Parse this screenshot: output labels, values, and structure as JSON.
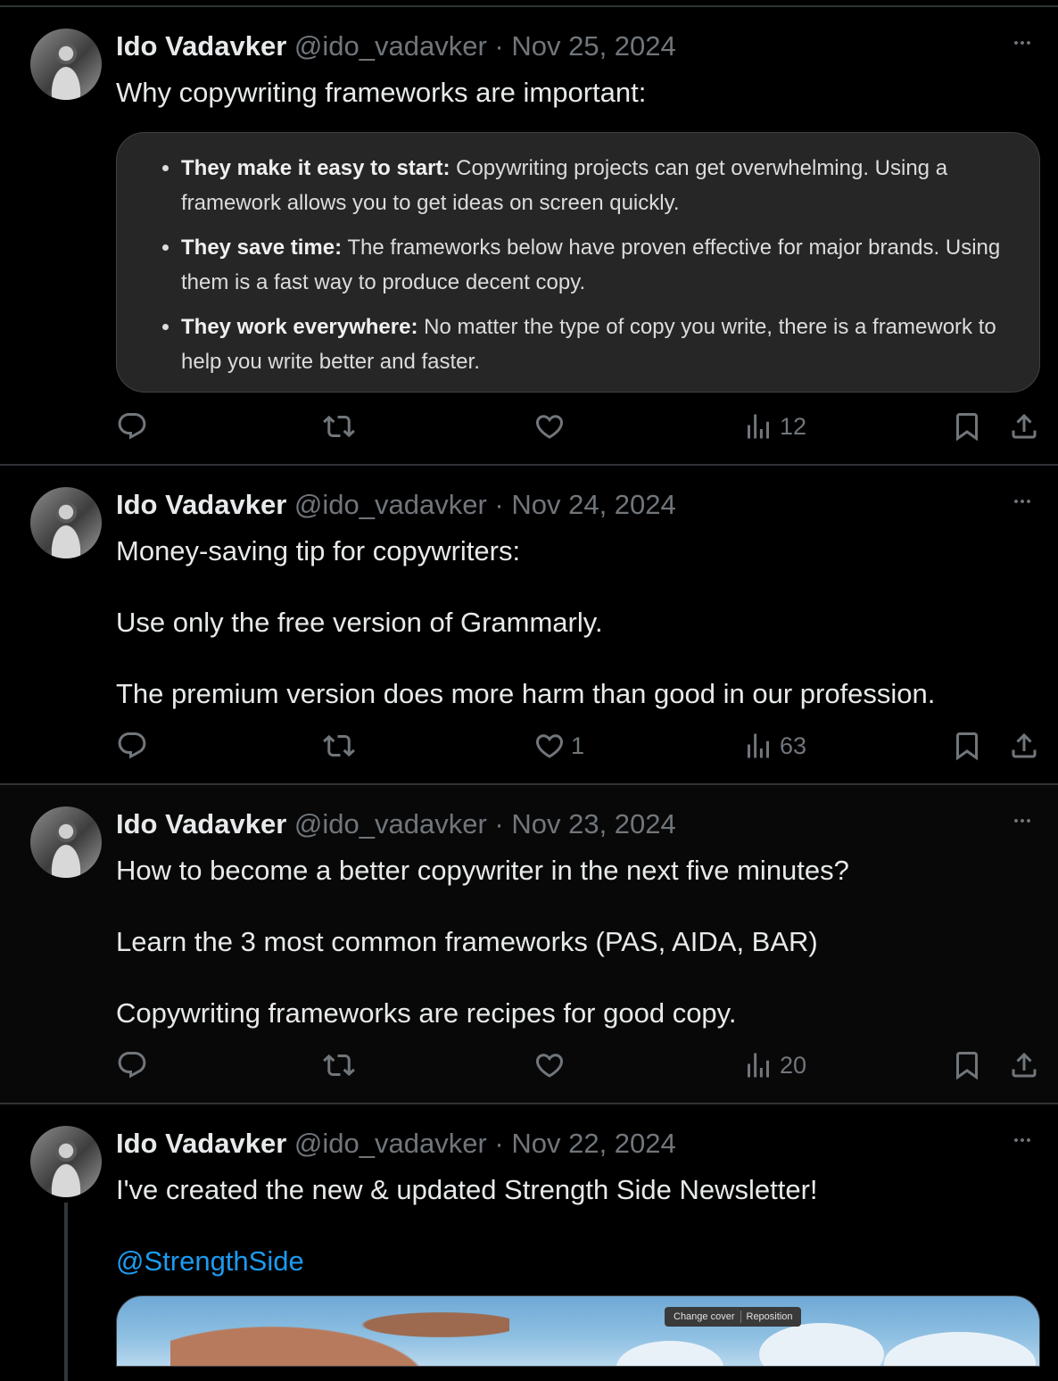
{
  "tweets": [
    {
      "name": "Ido Vadavker",
      "handle": "@ido_vadavker",
      "separator": "·",
      "date": "Nov 25, 2024",
      "text": "Why copywriting frameworks are important:",
      "card_items": [
        {
          "bold": "They make it easy to start:",
          "rest": " Copywriting projects can get overwhelming. Using a framework allows you to get ideas on screen quickly."
        },
        {
          "bold": "They save time:",
          "rest": " The frameworks below have proven effective for major brands. Using them is a fast way to produce decent copy."
        },
        {
          "bold": "They work everywhere:",
          "rest": " No matter the type of copy you write, there is a framework to help you write better and faster."
        }
      ],
      "reply_count": "",
      "retweet_count": "",
      "like_count": "",
      "view_count": "12"
    },
    {
      "name": "Ido Vadavker",
      "handle": "@ido_vadavker",
      "separator": "·",
      "date": "Nov 24, 2024",
      "text": "Money-saving tip for copywriters:\n\nUse only the free version of Grammarly.\n\nThe premium version does more harm than good in our profession.",
      "reply_count": "",
      "retweet_count": "",
      "like_count": "1",
      "view_count": "63"
    },
    {
      "name": "Ido Vadavker",
      "handle": "@ido_vadavker",
      "separator": "·",
      "date": "Nov 23, 2024",
      "text": "How to become a better copywriter in the next five minutes?\n\nLearn the 3 most common frameworks (PAS, AIDA, BAR)\n\nCopywriting frameworks are recipes for good copy.",
      "reply_count": "",
      "retweet_count": "",
      "like_count": "",
      "view_count": "20"
    },
    {
      "name": "Ido Vadavker",
      "handle": "@ido_vadavker",
      "separator": "·",
      "date": "Nov 22, 2024",
      "text": "I've created the new & updated Strength Side Newsletter!",
      "mention": "@StrengthSide",
      "media_buttons": {
        "change_cover": "Change cover",
        "reposition": "Reposition"
      }
    }
  ],
  "icons": {
    "reply": "reply-icon",
    "retweet": "retweet-icon",
    "like": "heart-icon",
    "views": "views-chart-icon",
    "bookmark": "bookmark-icon",
    "share": "share-icon",
    "more": "more-dots-icon"
  },
  "colors": {
    "background": "#000000",
    "text": "#e7e9ea",
    "secondary": "#71767b",
    "link": "#1d9bf0",
    "divider": "#2f3336"
  }
}
